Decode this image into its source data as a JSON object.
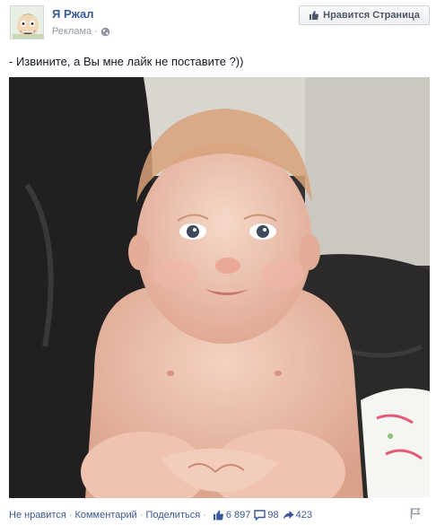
{
  "post": {
    "page_name": "Я Ржал",
    "sponsored_label": "Реклама",
    "like_page_button": "Нравится Страница",
    "text": "- Извините, а Вы мне лайк не поставите ?))",
    "photo_icon": "baby-photo"
  },
  "actions": {
    "unlike": "Не нравится",
    "comment": "Комментарий",
    "share": "Поделиться",
    "separator": "·",
    "likes_count": "6 897",
    "comments_count": "98",
    "shares_count": "423"
  },
  "colors": {
    "link": "#3b5998",
    "muted": "#9197a3"
  }
}
